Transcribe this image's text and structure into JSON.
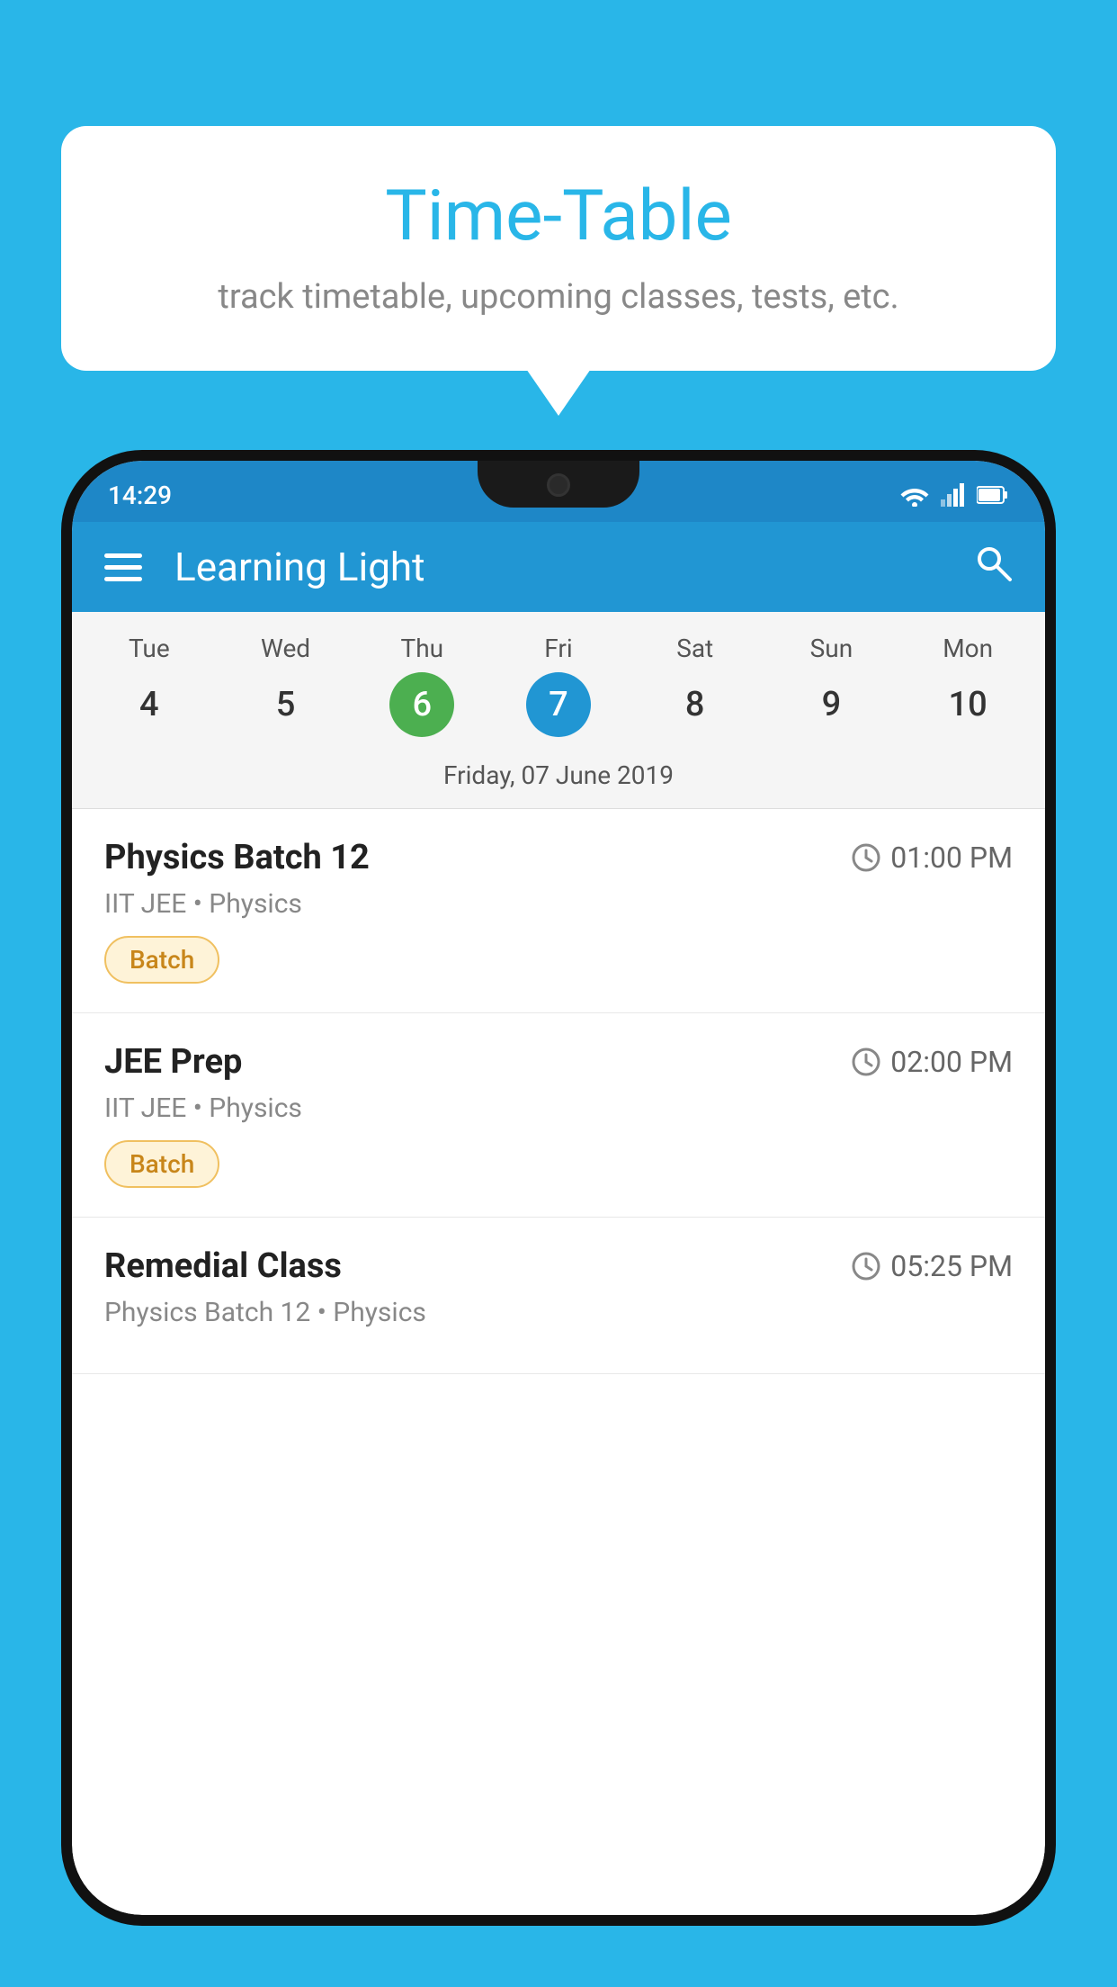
{
  "background_color": "#29b6e8",
  "bubble": {
    "title": "Time-Table",
    "subtitle": "track timetable, upcoming classes, tests, etc."
  },
  "status_bar": {
    "time": "14:29"
  },
  "app_bar": {
    "title": "Learning Light"
  },
  "calendar": {
    "weekdays": [
      "Tue",
      "Wed",
      "Thu",
      "Fri",
      "Sat",
      "Sun",
      "Mon"
    ],
    "dates": [
      {
        "num": "4",
        "type": "normal"
      },
      {
        "num": "5",
        "type": "normal"
      },
      {
        "num": "6",
        "type": "today"
      },
      {
        "num": "7",
        "type": "selected"
      },
      {
        "num": "8",
        "type": "normal"
      },
      {
        "num": "9",
        "type": "normal"
      },
      {
        "num": "10",
        "type": "normal"
      }
    ],
    "selected_date_label": "Friday, 07 June 2019"
  },
  "schedule": {
    "items": [
      {
        "title": "Physics Batch 12",
        "time": "01:00 PM",
        "subtitle": "IIT JEE • Physics",
        "badge": "Batch"
      },
      {
        "title": "JEE Prep",
        "time": "02:00 PM",
        "subtitle": "IIT JEE • Physics",
        "badge": "Batch"
      },
      {
        "title": "Remedial Class",
        "time": "05:25 PM",
        "subtitle": "Physics Batch 12 • Physics",
        "badge": null
      }
    ]
  }
}
